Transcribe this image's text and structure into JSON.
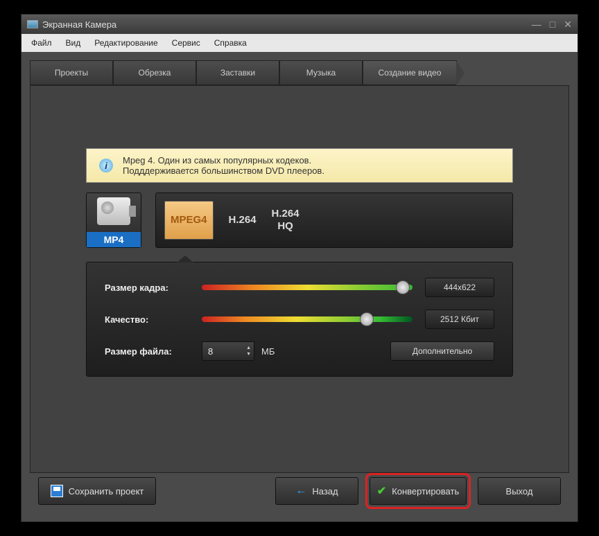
{
  "window": {
    "title": "Экранная Камера"
  },
  "menubar": [
    "Файл",
    "Вид",
    "Редактирование",
    "Сервис",
    "Справка"
  ],
  "tabs": [
    "Проекты",
    "Обрезка",
    "Заставки",
    "Музыка",
    "Создание видео"
  ],
  "active_tab": 4,
  "info": {
    "line1": "Mpeg 4. Один из самых популярных кодеков.",
    "line2": "Подддерживается большинством DVD плееров."
  },
  "format": {
    "label": "MP4"
  },
  "codecs": [
    {
      "label": "MPEG4",
      "active": true
    },
    {
      "label": "H.264",
      "active": false
    },
    {
      "label": "H.264\nHQ",
      "active": false
    }
  ],
  "settings": {
    "frame_size": {
      "label": "Размер кадра:",
      "value": "444x622",
      "pos": 92
    },
    "quality": {
      "label": "Качество:",
      "value": "2512 Кбит",
      "pos": 75
    },
    "file_size": {
      "label": "Размер файла:",
      "value": "8",
      "unit": "МБ"
    },
    "advanced": "Дополнительно"
  },
  "footer": {
    "save": "Сохранить проект",
    "back": "Назад",
    "convert": "Конвертировать",
    "exit": "Выход"
  }
}
